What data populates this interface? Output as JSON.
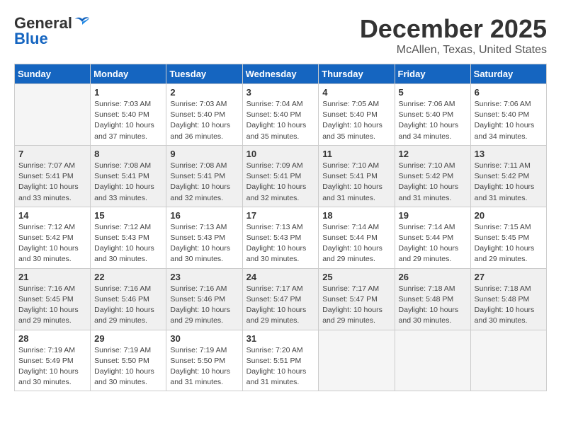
{
  "header": {
    "logo_line1": "General",
    "logo_line2": "Blue",
    "month": "December 2025",
    "location": "McAllen, Texas, United States"
  },
  "weekdays": [
    "Sunday",
    "Monday",
    "Tuesday",
    "Wednesday",
    "Thursday",
    "Friday",
    "Saturday"
  ],
  "weeks": [
    [
      {
        "day": "",
        "sunrise": "",
        "sunset": "",
        "daylight": ""
      },
      {
        "day": "1",
        "sunrise": "Sunrise: 7:03 AM",
        "sunset": "Sunset: 5:40 PM",
        "daylight": "Daylight: 10 hours and 37 minutes."
      },
      {
        "day": "2",
        "sunrise": "Sunrise: 7:03 AM",
        "sunset": "Sunset: 5:40 PM",
        "daylight": "Daylight: 10 hours and 36 minutes."
      },
      {
        "day": "3",
        "sunrise": "Sunrise: 7:04 AM",
        "sunset": "Sunset: 5:40 PM",
        "daylight": "Daylight: 10 hours and 35 minutes."
      },
      {
        "day": "4",
        "sunrise": "Sunrise: 7:05 AM",
        "sunset": "Sunset: 5:40 PM",
        "daylight": "Daylight: 10 hours and 35 minutes."
      },
      {
        "day": "5",
        "sunrise": "Sunrise: 7:06 AM",
        "sunset": "Sunset: 5:40 PM",
        "daylight": "Daylight: 10 hours and 34 minutes."
      },
      {
        "day": "6",
        "sunrise": "Sunrise: 7:06 AM",
        "sunset": "Sunset: 5:40 PM",
        "daylight": "Daylight: 10 hours and 34 minutes."
      }
    ],
    [
      {
        "day": "7",
        "sunrise": "Sunrise: 7:07 AM",
        "sunset": "Sunset: 5:41 PM",
        "daylight": "Daylight: 10 hours and 33 minutes."
      },
      {
        "day": "8",
        "sunrise": "Sunrise: 7:08 AM",
        "sunset": "Sunset: 5:41 PM",
        "daylight": "Daylight: 10 hours and 33 minutes."
      },
      {
        "day": "9",
        "sunrise": "Sunrise: 7:08 AM",
        "sunset": "Sunset: 5:41 PM",
        "daylight": "Daylight: 10 hours and 32 minutes."
      },
      {
        "day": "10",
        "sunrise": "Sunrise: 7:09 AM",
        "sunset": "Sunset: 5:41 PM",
        "daylight": "Daylight: 10 hours and 32 minutes."
      },
      {
        "day": "11",
        "sunrise": "Sunrise: 7:10 AM",
        "sunset": "Sunset: 5:41 PM",
        "daylight": "Daylight: 10 hours and 31 minutes."
      },
      {
        "day": "12",
        "sunrise": "Sunrise: 7:10 AM",
        "sunset": "Sunset: 5:42 PM",
        "daylight": "Daylight: 10 hours and 31 minutes."
      },
      {
        "day": "13",
        "sunrise": "Sunrise: 7:11 AM",
        "sunset": "Sunset: 5:42 PM",
        "daylight": "Daylight: 10 hours and 31 minutes."
      }
    ],
    [
      {
        "day": "14",
        "sunrise": "Sunrise: 7:12 AM",
        "sunset": "Sunset: 5:42 PM",
        "daylight": "Daylight: 10 hours and 30 minutes."
      },
      {
        "day": "15",
        "sunrise": "Sunrise: 7:12 AM",
        "sunset": "Sunset: 5:43 PM",
        "daylight": "Daylight: 10 hours and 30 minutes."
      },
      {
        "day": "16",
        "sunrise": "Sunrise: 7:13 AM",
        "sunset": "Sunset: 5:43 PM",
        "daylight": "Daylight: 10 hours and 30 minutes."
      },
      {
        "day": "17",
        "sunrise": "Sunrise: 7:13 AM",
        "sunset": "Sunset: 5:43 PM",
        "daylight": "Daylight: 10 hours and 30 minutes."
      },
      {
        "day": "18",
        "sunrise": "Sunrise: 7:14 AM",
        "sunset": "Sunset: 5:44 PM",
        "daylight": "Daylight: 10 hours and 29 minutes."
      },
      {
        "day": "19",
        "sunrise": "Sunrise: 7:14 AM",
        "sunset": "Sunset: 5:44 PM",
        "daylight": "Daylight: 10 hours and 29 minutes."
      },
      {
        "day": "20",
        "sunrise": "Sunrise: 7:15 AM",
        "sunset": "Sunset: 5:45 PM",
        "daylight": "Daylight: 10 hours and 29 minutes."
      }
    ],
    [
      {
        "day": "21",
        "sunrise": "Sunrise: 7:16 AM",
        "sunset": "Sunset: 5:45 PM",
        "daylight": "Daylight: 10 hours and 29 minutes."
      },
      {
        "day": "22",
        "sunrise": "Sunrise: 7:16 AM",
        "sunset": "Sunset: 5:46 PM",
        "daylight": "Daylight: 10 hours and 29 minutes."
      },
      {
        "day": "23",
        "sunrise": "Sunrise: 7:16 AM",
        "sunset": "Sunset: 5:46 PM",
        "daylight": "Daylight: 10 hours and 29 minutes."
      },
      {
        "day": "24",
        "sunrise": "Sunrise: 7:17 AM",
        "sunset": "Sunset: 5:47 PM",
        "daylight": "Daylight: 10 hours and 29 minutes."
      },
      {
        "day": "25",
        "sunrise": "Sunrise: 7:17 AM",
        "sunset": "Sunset: 5:47 PM",
        "daylight": "Daylight: 10 hours and 29 minutes."
      },
      {
        "day": "26",
        "sunrise": "Sunrise: 7:18 AM",
        "sunset": "Sunset: 5:48 PM",
        "daylight": "Daylight: 10 hours and 30 minutes."
      },
      {
        "day": "27",
        "sunrise": "Sunrise: 7:18 AM",
        "sunset": "Sunset: 5:48 PM",
        "daylight": "Daylight: 10 hours and 30 minutes."
      }
    ],
    [
      {
        "day": "28",
        "sunrise": "Sunrise: 7:19 AM",
        "sunset": "Sunset: 5:49 PM",
        "daylight": "Daylight: 10 hours and 30 minutes."
      },
      {
        "day": "29",
        "sunrise": "Sunrise: 7:19 AM",
        "sunset": "Sunset: 5:50 PM",
        "daylight": "Daylight: 10 hours and 30 minutes."
      },
      {
        "day": "30",
        "sunrise": "Sunrise: 7:19 AM",
        "sunset": "Sunset: 5:50 PM",
        "daylight": "Daylight: 10 hours and 31 minutes."
      },
      {
        "day": "31",
        "sunrise": "Sunrise: 7:20 AM",
        "sunset": "Sunset: 5:51 PM",
        "daylight": "Daylight: 10 hours and 31 minutes."
      },
      {
        "day": "",
        "sunrise": "",
        "sunset": "",
        "daylight": ""
      },
      {
        "day": "",
        "sunrise": "",
        "sunset": "",
        "daylight": ""
      },
      {
        "day": "",
        "sunrise": "",
        "sunset": "",
        "daylight": ""
      }
    ]
  ]
}
